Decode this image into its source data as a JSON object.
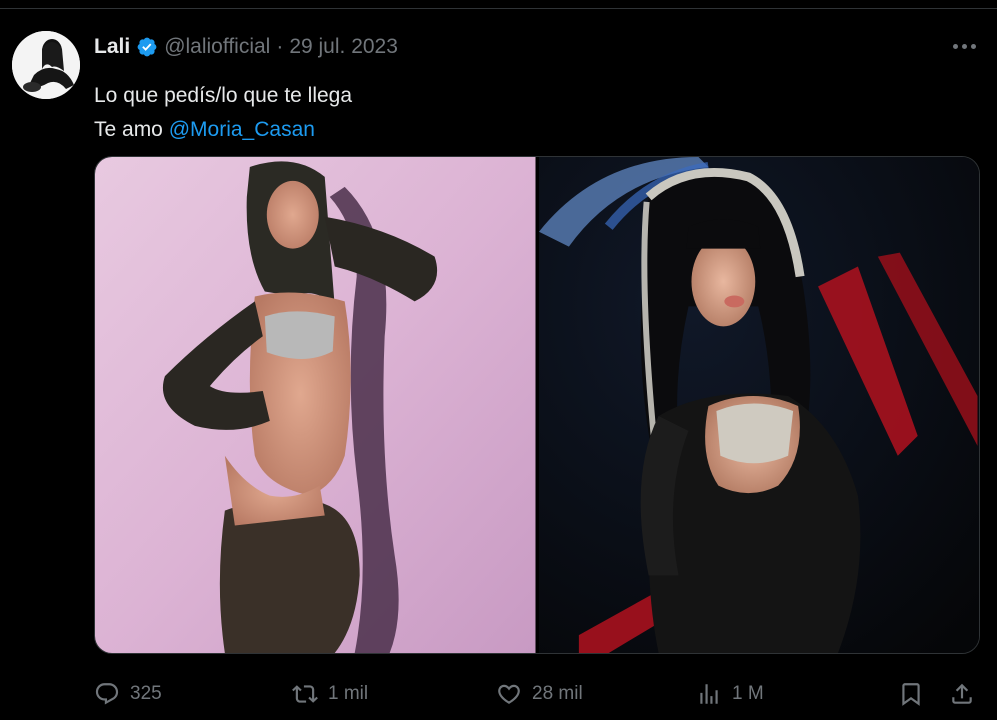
{
  "tweet": {
    "display_name": "Lali",
    "handle": "@laliofficial",
    "separator": "·",
    "date": "29 jul. 2023",
    "text_line1": "Lo que pedís/lo que te llega",
    "text_line2_prefix": "Te amo",
    "mention": "@Moria_Casan",
    "avatar_label": "Lali profile picture",
    "photos": [
      {
        "label": "Photo of performer in black lace costume on pink background"
      },
      {
        "label": "Photo of performer in black lace costume with jeweled headdress on dark background"
      }
    ]
  },
  "actions": {
    "replies": "325",
    "reposts": "1 mil",
    "likes": "28 mil",
    "views": "1 M"
  },
  "icons": {
    "verified": "verified-badge-icon",
    "more": "more-options-icon",
    "reply": "reply-icon",
    "repost": "repost-icon",
    "like": "heart-icon",
    "views": "views-icon",
    "bookmark": "bookmark-icon",
    "share": "share-icon"
  },
  "colors": {
    "background": "#000000",
    "text": "#e7e9ea",
    "muted": "#71767b",
    "accent": "#1d9bf0",
    "border": "#2f3336"
  }
}
